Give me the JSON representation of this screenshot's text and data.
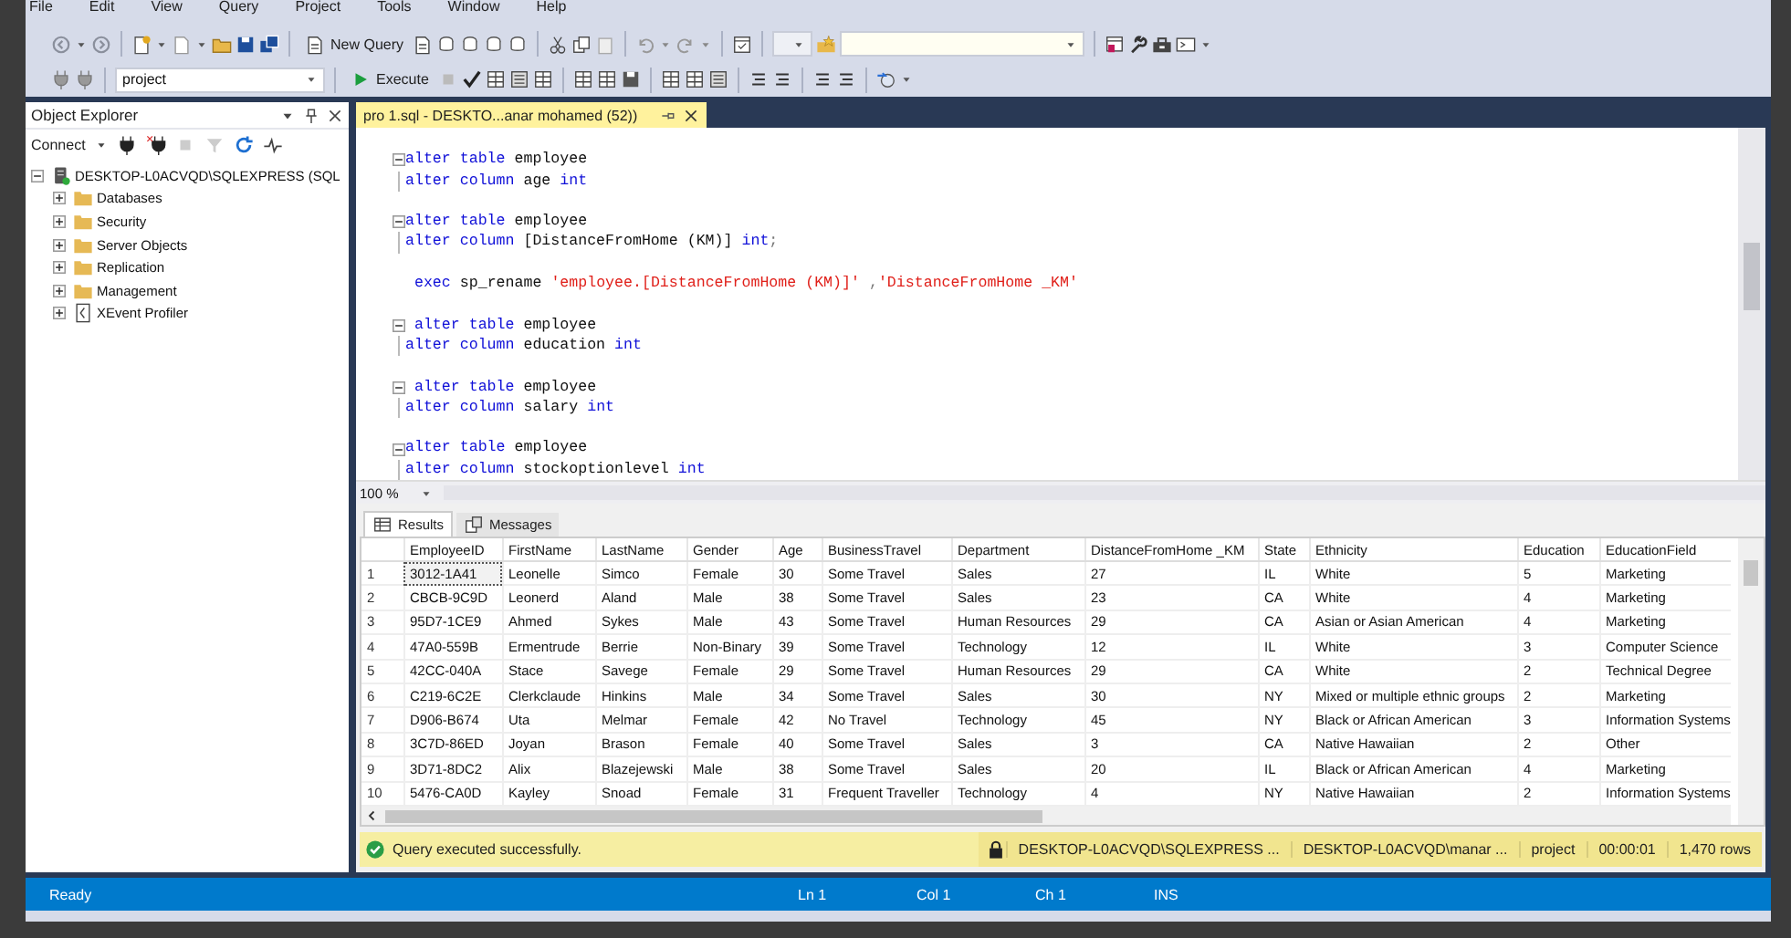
{
  "menu": [
    "File",
    "Edit",
    "View",
    "Query",
    "Project",
    "Tools",
    "Window",
    "Help"
  ],
  "toolbar": {
    "new_query": "New Query",
    "database": "project",
    "execute": "Execute"
  },
  "object_explorer": {
    "title": "Object Explorer",
    "connect": "Connect",
    "tree": [
      {
        "label": "DESKTOP-L0ACVQD\\SQLEXPRESS (SQL",
        "kind": "server",
        "expanded": true,
        "children": [
          {
            "label": "Databases",
            "kind": "folder",
            "expanded": false
          },
          {
            "label": "Security",
            "kind": "folder",
            "expanded": false
          },
          {
            "label": "Server Objects",
            "kind": "folder",
            "expanded": false
          },
          {
            "label": "Replication",
            "kind": "folder",
            "expanded": false
          },
          {
            "label": "Management",
            "kind": "folder",
            "expanded": false
          },
          {
            "label": "XEvent Profiler",
            "kind": "profiler",
            "expanded": false
          }
        ]
      }
    ]
  },
  "editor": {
    "tab": "pro 1.sql - DESKTO...anar mohamed (52))",
    "zoom": "100 %",
    "blocks": [
      {
        "fold": true,
        "lines": [
          [
            {
              "kind": "keyword",
              "text": "alter table"
            },
            {
              "kind": "identifier",
              "text": " employee"
            }
          ],
          [
            {
              "kind": "keyword",
              "text": "alter column"
            },
            {
              "kind": "identifier",
              "text": " age "
            },
            {
              "kind": "keyword",
              "text": "int"
            }
          ]
        ]
      },
      {
        "fold": true,
        "lines": [
          [
            {
              "kind": "keyword",
              "text": "alter table"
            },
            {
              "kind": "identifier",
              "text": " employee"
            }
          ],
          [
            {
              "kind": "keyword",
              "text": "alter column"
            },
            {
              "kind": "identifier",
              "text": " [DistanceFromHome (KM)] "
            },
            {
              "kind": "keyword",
              "text": "int"
            },
            {
              "kind": "operator",
              "text": ";"
            }
          ]
        ]
      },
      {
        "fold": false,
        "lines": [
          [
            {
              "kind": "keyword",
              "text": " exec"
            },
            {
              "kind": "identifier",
              "text": " sp_rename "
            },
            {
              "kind": "string",
              "text": "'employee.[DistanceFromHome (KM)]'"
            },
            {
              "kind": "operator",
              "text": " ,"
            },
            {
              "kind": "string",
              "text": "'DistanceFromHome _KM'"
            }
          ]
        ]
      },
      {
        "fold": true,
        "lines": [
          [
            {
              "kind": "keyword",
              "text": " alter table"
            },
            {
              "kind": "identifier",
              "text": " employee"
            }
          ],
          [
            {
              "kind": "keyword",
              "text": "alter column"
            },
            {
              "kind": "identifier",
              "text": " education "
            },
            {
              "kind": "keyword",
              "text": "int"
            }
          ]
        ]
      },
      {
        "fold": true,
        "lines": [
          [
            {
              "kind": "keyword",
              "text": " alter table"
            },
            {
              "kind": "identifier",
              "text": " employee"
            }
          ],
          [
            {
              "kind": "keyword",
              "text": "alter column"
            },
            {
              "kind": "identifier",
              "text": " salary "
            },
            {
              "kind": "keyword",
              "text": "int"
            }
          ]
        ]
      },
      {
        "fold": true,
        "lines": [
          [
            {
              "kind": "keyword",
              "text": "alter table"
            },
            {
              "kind": "identifier",
              "text": " employee"
            }
          ],
          [
            {
              "kind": "keyword",
              "text": "alter column"
            },
            {
              "kind": "identifier",
              "text": " stockoptionlevel "
            },
            {
              "kind": "keyword",
              "text": "int"
            }
          ]
        ]
      }
    ]
  },
  "results": {
    "tabs": [
      {
        "label": "Results",
        "selected": true
      },
      {
        "label": "Messages",
        "selected": false
      }
    ],
    "columns": [
      "EmployeeID",
      "FirstName",
      "LastName",
      "Gender",
      "Age",
      "BusinessTravel",
      "Department",
      "DistanceFromHome _KM",
      "State",
      "Ethnicity",
      "Education",
      "EducationField"
    ],
    "rows": [
      {
        "n": "1",
        "focused": true,
        "cells": [
          "3012-1A41",
          "Leonelle",
          "Simco",
          "Female",
          "30",
          "Some Travel",
          "Sales",
          "27",
          "IL",
          "White",
          "5",
          "Marketing"
        ]
      },
      {
        "n": "2",
        "focused": false,
        "cells": [
          "CBCB-9C9D",
          "Leonerd",
          "Aland",
          "Male",
          "38",
          "Some Travel",
          "Sales",
          "23",
          "CA",
          "White",
          "4",
          "Marketing"
        ]
      },
      {
        "n": "3",
        "focused": false,
        "cells": [
          "95D7-1CE9",
          "Ahmed",
          "Sykes",
          "Male",
          "43",
          "Some Travel",
          "Human Resources",
          "29",
          "CA",
          "Asian or Asian American",
          "4",
          "Marketing"
        ]
      },
      {
        "n": "4",
        "focused": false,
        "cells": [
          "47A0-559B",
          "Ermentrude",
          "Berrie",
          "Non-Binary",
          "39",
          "Some Travel",
          "Technology",
          "12",
          "IL",
          "White",
          "3",
          "Computer Science"
        ]
      },
      {
        "n": "5",
        "focused": false,
        "cells": [
          "42CC-040A",
          "Stace",
          "Savege",
          "Female",
          "29",
          "Some Travel",
          "Human Resources",
          "29",
          "CA",
          "White",
          "2",
          "Technical Degree"
        ]
      },
      {
        "n": "6",
        "focused": false,
        "cells": [
          "C219-6C2E",
          "Clerkclaude",
          "Hinkins",
          "Male",
          "34",
          "Some Travel",
          "Sales",
          "30",
          "NY",
          "Mixed or multiple ethnic groups",
          "2",
          "Marketing"
        ]
      },
      {
        "n": "7",
        "focused": false,
        "cells": [
          "D906-B674",
          "Uta",
          "Melmar",
          "Female",
          "42",
          "No Travel",
          "Technology",
          "45",
          "NY",
          "Black or African American",
          "3",
          "Information Systems"
        ]
      },
      {
        "n": "8",
        "focused": false,
        "cells": [
          "3C7D-86ED",
          "Joyan",
          "Brason",
          "Female",
          "40",
          "Some Travel",
          "Sales",
          "3",
          "CA",
          "Native Hawaiian",
          "2",
          "Other"
        ]
      },
      {
        "n": "9",
        "focused": false,
        "cells": [
          "3D71-8DC2",
          "Alix",
          "Blazejewski",
          "Male",
          "38",
          "Some Travel",
          "Sales",
          "20",
          "IL",
          "Black or African American",
          "4",
          "Marketing"
        ]
      },
      {
        "n": "10",
        "focused": false,
        "cells": [
          "5476-CA0D",
          "Kayley",
          "Snoad",
          "Female",
          "31",
          "Frequent Traveller",
          "Technology",
          "4",
          "NY",
          "Native Hawaiian",
          "2",
          "Information Systems"
        ]
      }
    ]
  },
  "query_status": {
    "message": "Query executed successfully.",
    "segments": [
      "DESKTOP-L0ACVQD\\SQLEXPRESS ...",
      "DESKTOP-L0ACVQD\\manar ...",
      "project",
      "00:00:01",
      "1,470 rows"
    ]
  },
  "status_bar": {
    "ready": "Ready",
    "items": [
      "Ln 1",
      "Col 1",
      "Ch 1",
      "INS"
    ]
  }
}
